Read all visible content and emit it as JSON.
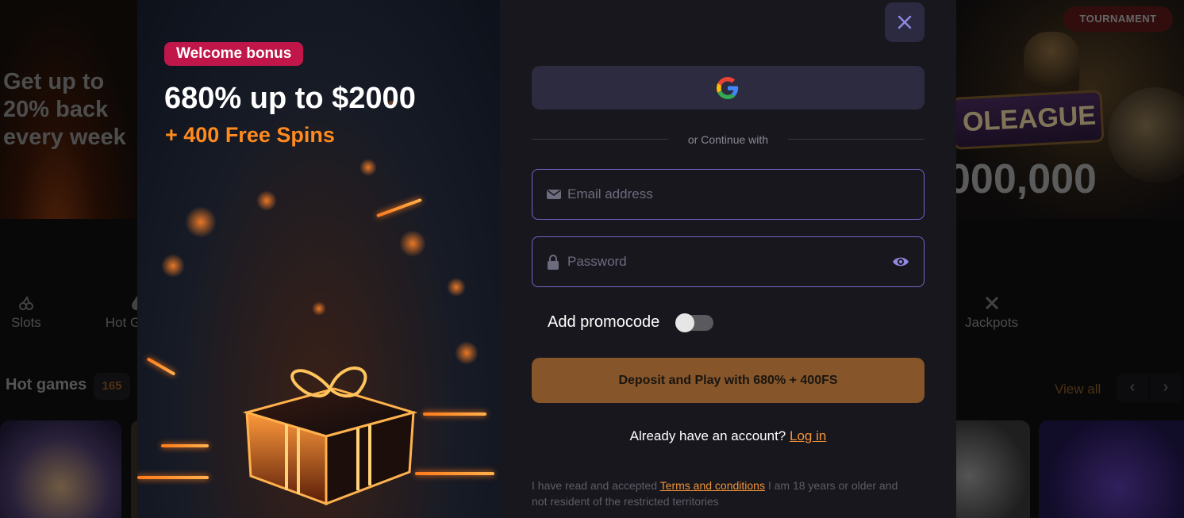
{
  "background": {
    "left_banner": {
      "promo_text": [
        "Get up to",
        "20% back",
        "every week"
      ]
    },
    "right_banner": {
      "badge": "TOURNAMENT",
      "logo_text": "OLEAGUE",
      "amount": "000,000"
    },
    "categories": [
      {
        "label": "Slots",
        "icon": "cherries-icon"
      },
      {
        "label": "Hot G",
        "icon": "flame-icon"
      },
      {
        "label": "Jackpots",
        "icon": "crossed-swords-icon"
      }
    ],
    "hot_games": {
      "title": "Hot games",
      "count": "165",
      "view_all": "View all"
    }
  },
  "modal": {
    "bonus": {
      "badge": "Welcome bonus",
      "headline": "680% up to $2000",
      "subline": "+ 400 Free Spins"
    },
    "divider_text": "or Continue with",
    "email_placeholder": "Email address",
    "password_placeholder": "Password",
    "promocode_label": "Add promocode",
    "promocode_enabled": false,
    "deposit_button": "Deposit and Play with 680% + 400FS",
    "account_prompt": "Already have an account?",
    "login_link": "Log in",
    "terms": {
      "prefix": "I have read and accepted",
      "link": "Terms and conditions",
      "suffix": "I am 18 years or older and not resident of the restricted territories"
    },
    "colors": {
      "accent": "#6f66c9",
      "bonus_badge": "#c1164a",
      "cta": "#86552a",
      "link": "#f0933a"
    }
  }
}
